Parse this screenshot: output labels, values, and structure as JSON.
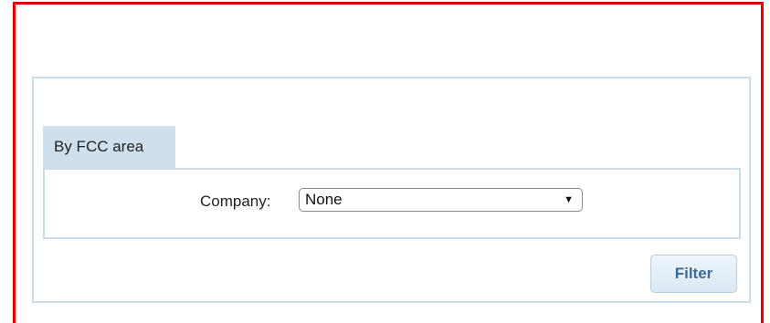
{
  "tab": {
    "label": "By FCC area"
  },
  "company": {
    "label": "Company:",
    "selected": "None",
    "arrow": "▼"
  },
  "filter_button": {
    "label": "Filter"
  },
  "colors": {
    "frame": "#e80000",
    "panel_border": "#c8dcea",
    "tab_background": "#cfe0ec",
    "button_text": "#3d6a93"
  },
  "icons": {
    "dropdown": "triangle-down"
  }
}
